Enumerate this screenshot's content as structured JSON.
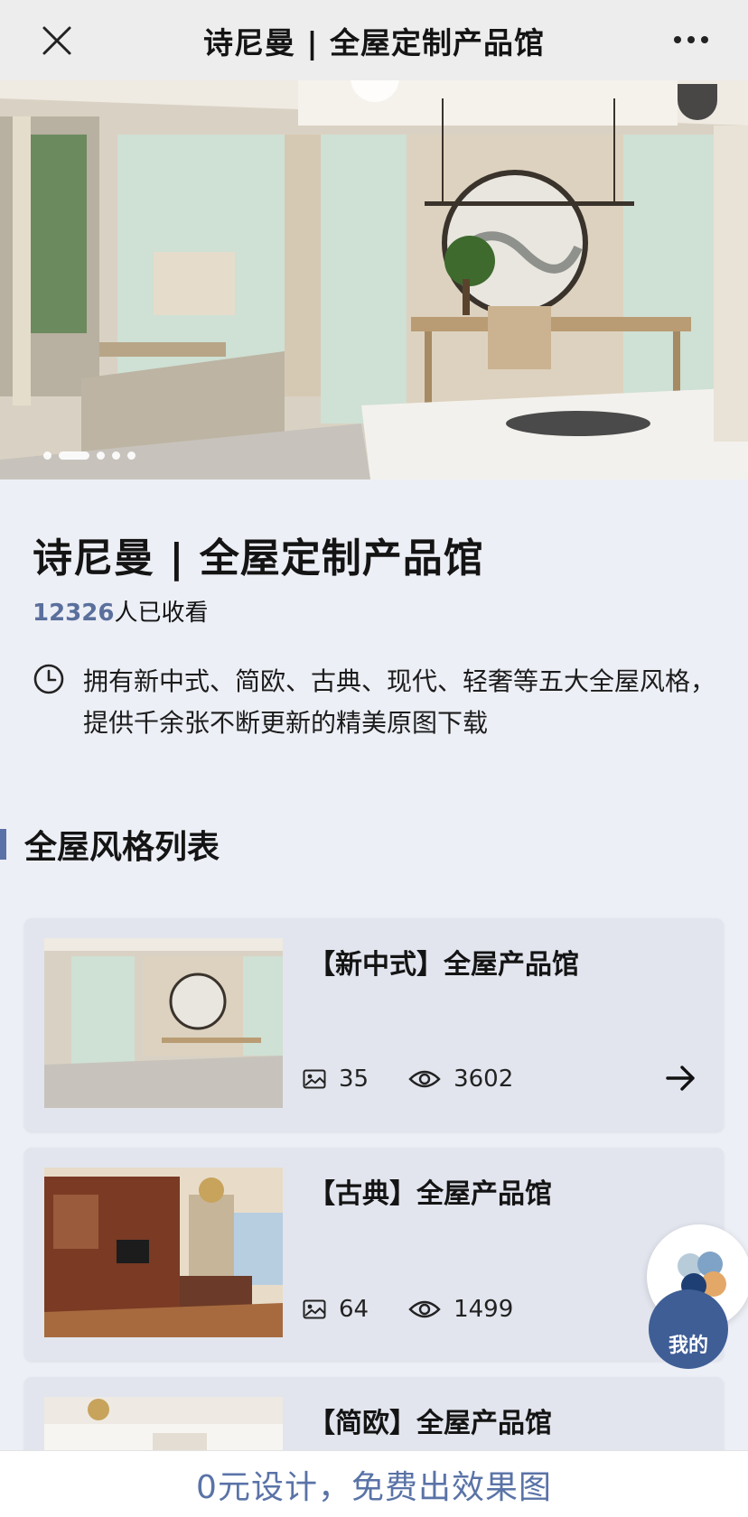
{
  "topbar": {
    "title": "诗尼曼 | 全屋定制产品馆"
  },
  "hero": {
    "slide_count": 5,
    "active_index": 1
  },
  "info": {
    "title": "诗尼曼 | 全屋定制产品馆",
    "view_count": "12326",
    "view_suffix": "人已收看",
    "description": "拥有新中式、简欧、古典、现代、轻奢等五大全屋风格，提供千余张不断更新的精美原图下载"
  },
  "section": {
    "title": "全屋风格列表"
  },
  "cards": [
    {
      "title": "【新中式】全屋产品馆",
      "photos": "35",
      "views": "3602"
    },
    {
      "title": "【古典】全屋产品馆",
      "photos": "64",
      "views": "1499"
    },
    {
      "title": "【简欧】全屋产品馆"
    }
  ],
  "fab": {
    "label": "我的"
  },
  "bottom": {
    "cta": "0元设计，免费出效果图"
  },
  "colors": {
    "accent": "#5b72a8",
    "page_bg": "#edeff6",
    "card_bg": "#e2e5ee",
    "cta_text": "#5a73a7"
  }
}
